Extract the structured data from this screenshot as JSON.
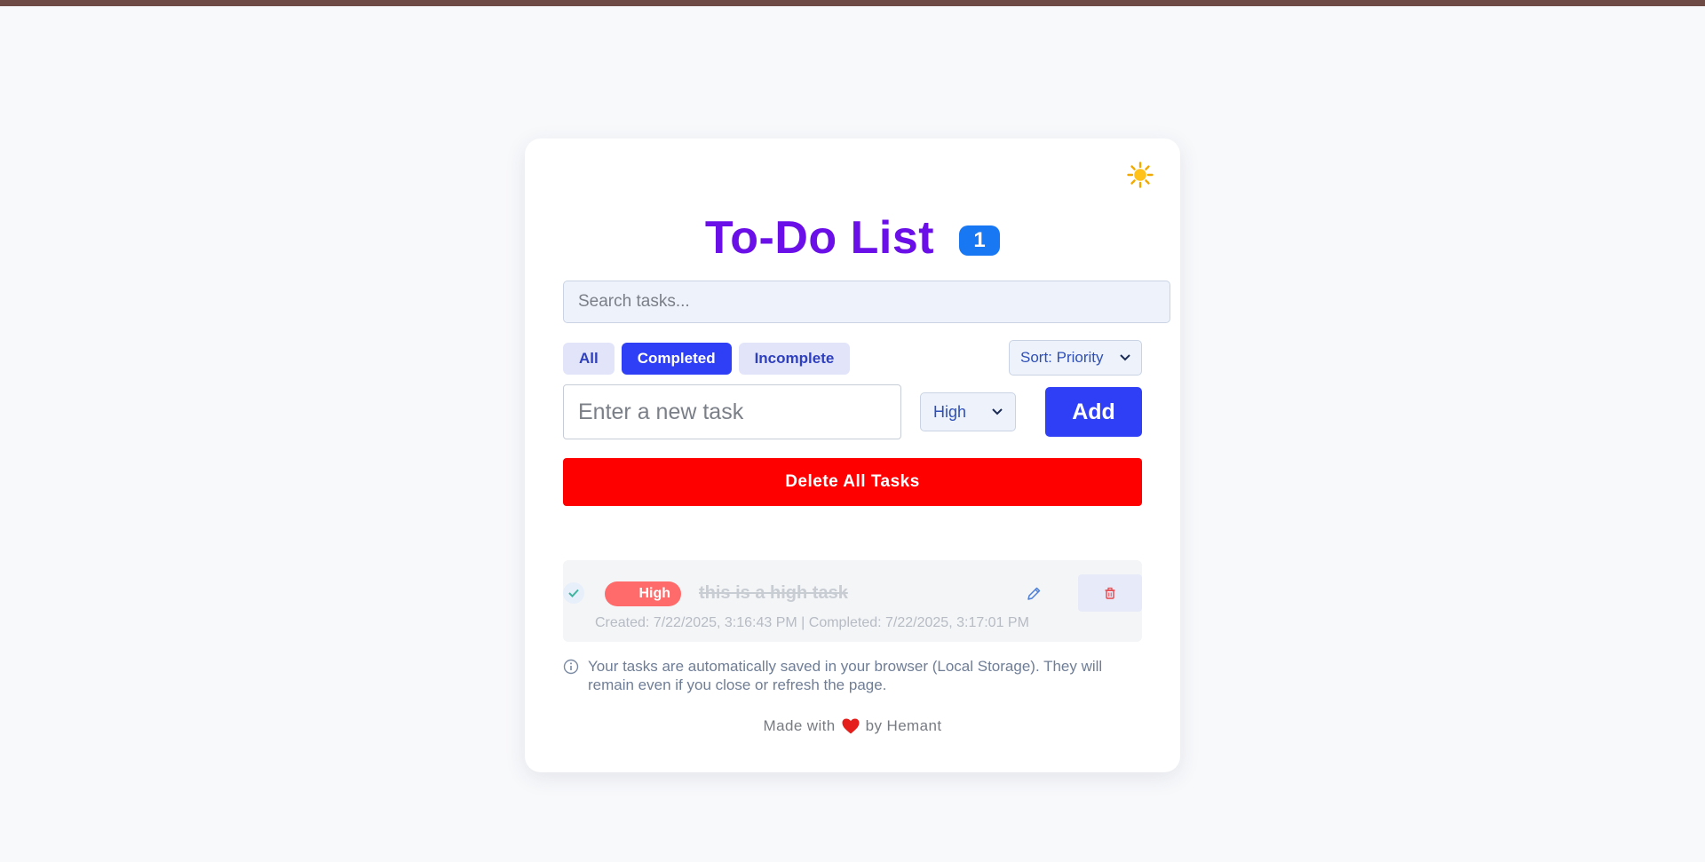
{
  "header": {
    "title": "To-Do List",
    "task_count": "1",
    "theme_icon": "sun-icon"
  },
  "search": {
    "placeholder": "Search tasks...",
    "value": ""
  },
  "filters": {
    "items": [
      {
        "label": "All",
        "active": false
      },
      {
        "label": "Completed",
        "active": true
      },
      {
        "label": "Incomplete",
        "active": false
      }
    ]
  },
  "sort": {
    "selected": "Sort: Priority"
  },
  "new_task": {
    "placeholder": "Enter a new task",
    "value": "",
    "priority_selected": "High",
    "add_label": "Add"
  },
  "delete_all_label": "Delete All Tasks",
  "tasks": [
    {
      "priority": "High",
      "text": "this is a high task",
      "completed": true,
      "meta": "Created: 7/22/2025, 3:16:43 PM | Completed: 7/22/2025, 3:17:01 PM"
    }
  ],
  "info_text": "Your tasks are automatically saved in your browser (Local Storage). They will remain even if you close or refresh the page.",
  "footer": {
    "prefix": "Made with",
    "suffix": "by Hemant"
  },
  "colors": {
    "title": "#6a0fe8",
    "primary": "#2f3ff5",
    "danger": "#ff0000",
    "high_priority": "#ff6b6b",
    "badge": "#1877f2"
  }
}
